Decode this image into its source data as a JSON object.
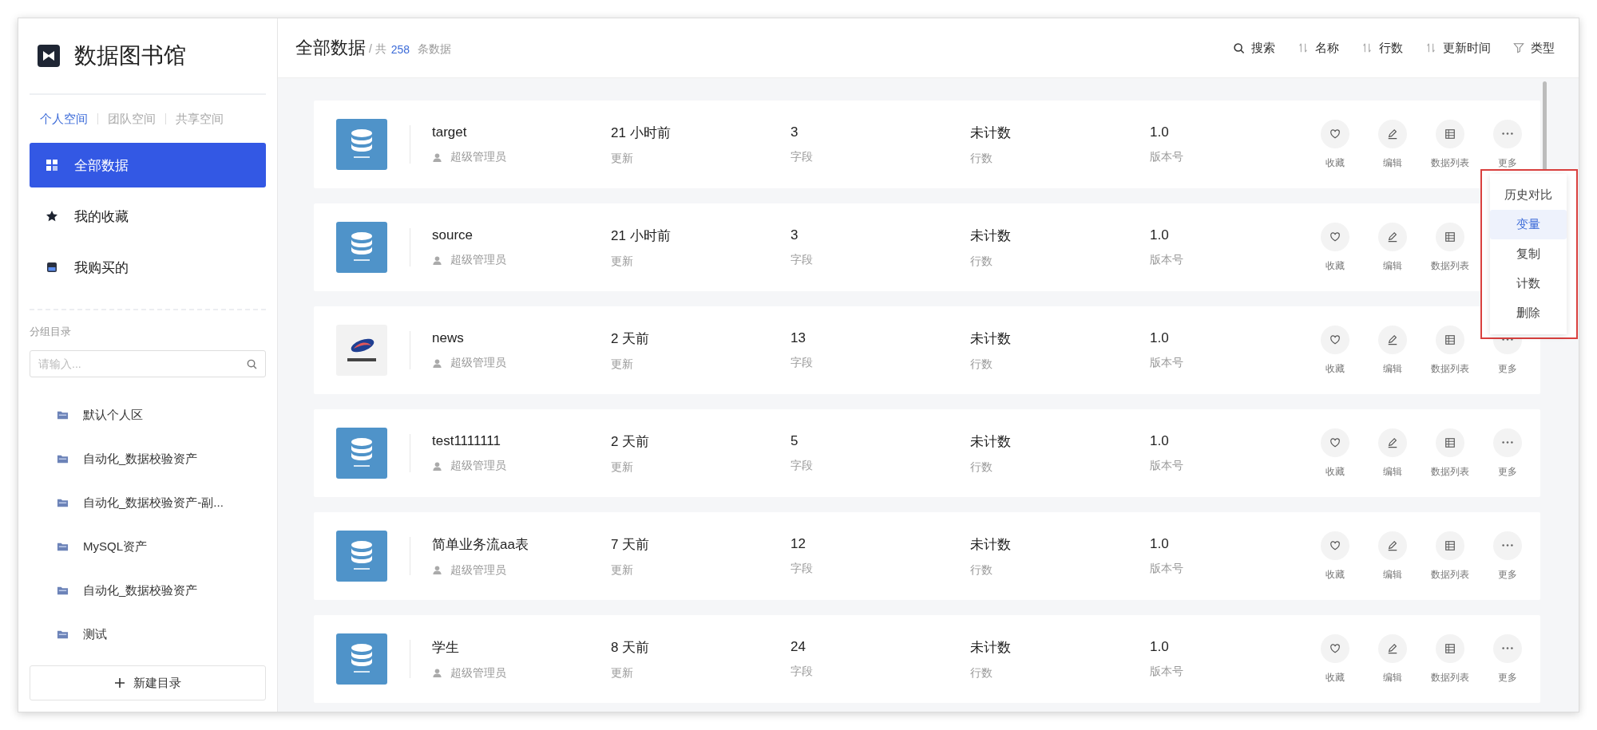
{
  "sidebar": {
    "title": "数据图书馆",
    "spaces": [
      {
        "label": "个人空间",
        "selected": true
      },
      {
        "label": "团队空间",
        "selected": false
      },
      {
        "label": "共享空间",
        "selected": false
      }
    ],
    "nav": [
      {
        "label": "全部数据",
        "selected": true
      },
      {
        "label": "我的收藏",
        "selected": false
      },
      {
        "label": "我购买的",
        "selected": false
      }
    ],
    "group_heading": "分组目录",
    "search": {
      "placeholder": "请输入..."
    },
    "folders": [
      "默认个人区",
      "自动化_数据校验资产",
      "自动化_数据校验资产-副...",
      "MySQL资产",
      "自动化_数据校验资产",
      "测试"
    ],
    "new_folder_button": "新建目录"
  },
  "header": {
    "title": "全部数据",
    "count_prefix": "/ 共",
    "count": "258",
    "count_suffix": "条数据",
    "tools": [
      {
        "label": "搜索",
        "kind": "search"
      },
      {
        "label": "名称",
        "kind": "sort"
      },
      {
        "label": "行数",
        "kind": "sort"
      },
      {
        "label": "更新时间",
        "kind": "sort"
      },
      {
        "label": "类型",
        "kind": "filter"
      }
    ]
  },
  "rows": [
    {
      "kind": "mysql",
      "name": "target",
      "owner": "超级管理员",
      "updated": "21 小时前",
      "updated_label": "更新",
      "fields": "3",
      "fields_label": "字段",
      "row_count": "未计数",
      "row_count_label": "行数",
      "version": "1.0",
      "version_label": "版本号",
      "actions": [
        {
          "kind": "favorite",
          "label": "收藏"
        },
        {
          "kind": "edit",
          "label": "编辑"
        },
        {
          "kind": "table",
          "label": "数据列表"
        },
        {
          "kind": "more",
          "label": "更多"
        }
      ]
    },
    {
      "kind": "mysql",
      "name": "source",
      "owner": "超级管理员",
      "updated": "21 小时前",
      "updated_label": "更新",
      "fields": "3",
      "fields_label": "字段",
      "row_count": "未计数",
      "row_count_label": "行数",
      "version": "1.0",
      "version_label": "版本号",
      "actions": [
        {
          "kind": "favorite",
          "label": "收藏"
        },
        {
          "kind": "edit",
          "label": "编辑"
        },
        {
          "kind": "table",
          "label": "数据列表"
        }
      ]
    },
    {
      "kind": "other",
      "name": "news",
      "owner": "超级管理员",
      "updated": "2 天前",
      "updated_label": "更新",
      "fields": "13",
      "fields_label": "字段",
      "row_count": "未计数",
      "row_count_label": "行数",
      "version": "1.0",
      "version_label": "版本号",
      "actions": [
        {
          "kind": "favorite",
          "label": "收藏"
        },
        {
          "kind": "edit",
          "label": "编辑"
        },
        {
          "kind": "table",
          "label": "数据列表"
        },
        {
          "kind": "more",
          "label": "更多"
        }
      ]
    },
    {
      "kind": "mysql",
      "name": "test1111111",
      "owner": "超级管理员",
      "updated": "2 天前",
      "updated_label": "更新",
      "fields": "5",
      "fields_label": "字段",
      "row_count": "未计数",
      "row_count_label": "行数",
      "version": "1.0",
      "version_label": "版本号",
      "actions": [
        {
          "kind": "favorite",
          "label": "收藏"
        },
        {
          "kind": "edit",
          "label": "编辑"
        },
        {
          "kind": "table",
          "label": "数据列表"
        },
        {
          "kind": "more",
          "label": "更多"
        }
      ]
    },
    {
      "kind": "mysql",
      "name": "简单业务流aa表",
      "owner": "超级管理员",
      "updated": "7 天前",
      "updated_label": "更新",
      "fields": "12",
      "fields_label": "字段",
      "row_count": "未计数",
      "row_count_label": "行数",
      "version": "1.0",
      "version_label": "版本号",
      "actions": [
        {
          "kind": "favorite",
          "label": "收藏"
        },
        {
          "kind": "edit",
          "label": "编辑"
        },
        {
          "kind": "table",
          "label": "数据列表"
        },
        {
          "kind": "more",
          "label": "更多"
        }
      ]
    },
    {
      "kind": "mysql",
      "name": "学生",
      "owner": "超级管理员",
      "updated": "8 天前",
      "updated_label": "更新",
      "fields": "24",
      "fields_label": "字段",
      "row_count": "未计数",
      "row_count_label": "行数",
      "version": "1.0",
      "version_label": "版本号",
      "actions": [
        {
          "kind": "favorite",
          "label": "收藏"
        },
        {
          "kind": "edit",
          "label": "编辑"
        },
        {
          "kind": "table",
          "label": "数据列表"
        },
        {
          "kind": "more",
          "label": "更多"
        }
      ]
    }
  ],
  "menu": {
    "items": [
      {
        "label": "历史对比",
        "selected": false
      },
      {
        "label": "变量",
        "selected": true
      },
      {
        "label": "复制",
        "selected": false
      },
      {
        "label": "计数",
        "selected": false
      },
      {
        "label": "删除",
        "selected": false
      }
    ]
  }
}
